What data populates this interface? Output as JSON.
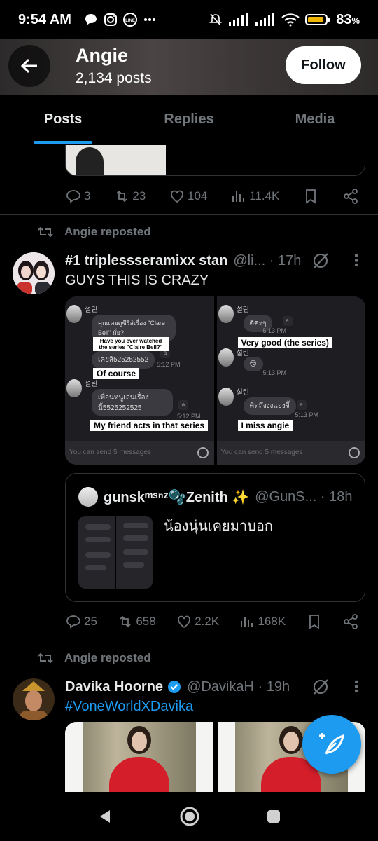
{
  "status_bar": {
    "time": "9:54 AM",
    "battery": "83",
    "battery_unit": "%",
    "left_icons": [
      "chat-bubble-icon",
      "instagram-icon",
      "line-app-icon",
      "more-dots-icon"
    ],
    "right_icons": [
      "mute-icon",
      "signal-icon",
      "signal-icon",
      "wifi-icon",
      "battery-icon"
    ]
  },
  "profile": {
    "name": "Angie",
    "posts_count": "2,134 posts",
    "follow_label": "Follow"
  },
  "tabs": [
    {
      "label": "Posts",
      "active": true
    },
    {
      "label": "Replies",
      "active": false
    },
    {
      "label": "Media",
      "active": false
    }
  ],
  "prev_post": {
    "replies": "3",
    "reposts": "23",
    "likes": "104",
    "views": "11.4K"
  },
  "post1": {
    "repost_label": "Angie reposted",
    "author": "#1 triplessseramixx stan",
    "handle": "@li...",
    "time": "· 17h",
    "text": "GUYS THIS IS CRAZY",
    "media": {
      "left": {
        "name": "설린",
        "bubble1": "คุณเคยดูซีรีส์เรื่อง \"Clare Bell\" มั้ย?",
        "bubble2": "เคยสิ525252552",
        "time2": "5:12 PM",
        "name2": "설린",
        "bubble3": "เพื่อนหนูเล่นเรื่องนี้5525252525",
        "time3": "5:12 PM",
        "input_placeholder": "You can send 5 messages",
        "tl1": "Have you ever watched the series \"Claire Bell?\"",
        "tl2": "Of course",
        "tl3": "My friend acts in that series"
      },
      "right": {
        "name": "설린",
        "bubble1": "ดีค่ะๆ",
        "time1": "5:13 PM",
        "name2": "설린",
        "bubble2": "😏",
        "time2": "5:13 PM",
        "name3": "설린",
        "bubble3": "คิดถึงงงแองจี้",
        "time3": "5:13 PM",
        "input_placeholder": "You can send 5 messages",
        "tl1": "Very good (the series)",
        "tl2": "I miss angie"
      }
    },
    "quote": {
      "author": "gunskᵐˢⁿᶻ🫧Zenith ✨",
      "handle": "@GunS...",
      "time": "· 18h",
      "text": "น้องนุ่นเคยมาบอก"
    },
    "replies": "25",
    "reposts": "658",
    "likes": "2.2K",
    "views": "168K"
  },
  "post2": {
    "repost_label": "Angie reposted",
    "author": "Davika Hoorne",
    "handle": "@DavikaH",
    "time": "· 19h",
    "text": "#VoneWorldXDavika"
  },
  "colors": {
    "accent": "#1d9bf0",
    "muted": "#71767b",
    "text": "#e7e9ea",
    "border": "#2f3336"
  }
}
